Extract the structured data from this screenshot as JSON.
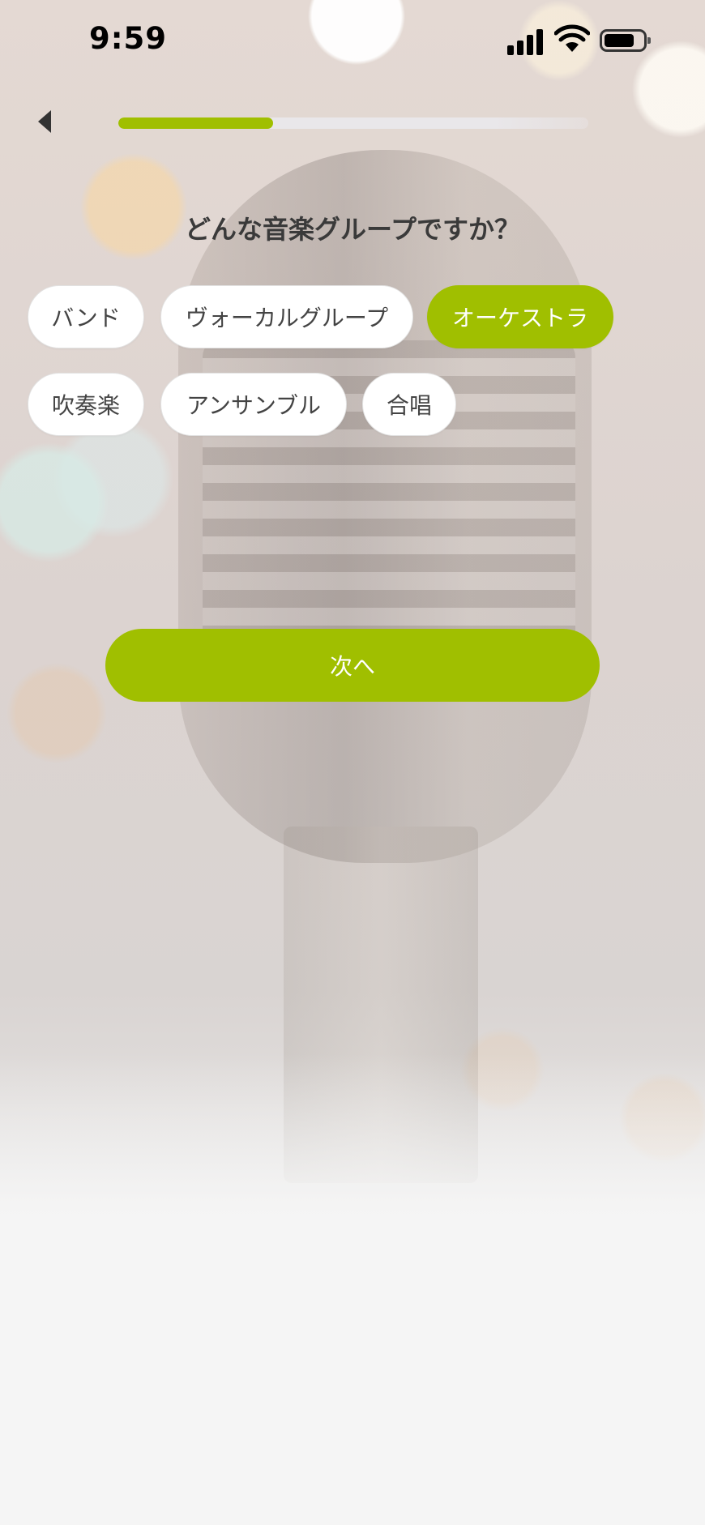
{
  "status_bar": {
    "time": "9:59",
    "signal_icon": "cellular-signal-icon",
    "wifi_icon": "wifi-icon",
    "battery_icon": "battery-icon",
    "battery_level": 0.8
  },
  "nav": {
    "back_icon": "back-triangle-icon",
    "progress": 0.33,
    "progress_color": "#a0bf00"
  },
  "question": "どんな音楽グループですか？",
  "options": [
    {
      "label": "バンド",
      "selected": false
    },
    {
      "label": "ヴォーカルグループ",
      "selected": false
    },
    {
      "label": "オーケストラ",
      "selected": true
    },
    {
      "label": "吹奏楽",
      "selected": false
    },
    {
      "label": "アンサンブル",
      "selected": false
    },
    {
      "label": "合唱",
      "selected": false
    }
  ],
  "next_button": {
    "label": "次へ"
  },
  "colors": {
    "accent": "#a0bf00",
    "chip_background": "#ffffff",
    "text": "#3a3a3a"
  }
}
